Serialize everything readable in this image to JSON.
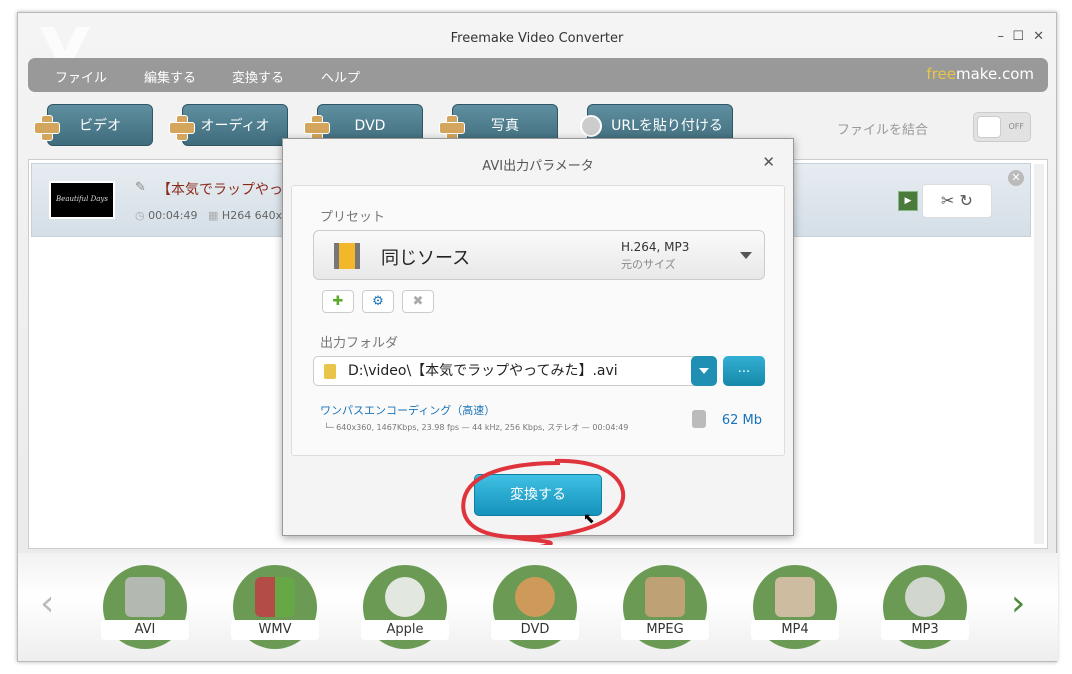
{
  "window": {
    "title": "Freemake Video Converter",
    "minimize": "–",
    "maximize": "☐",
    "close": "✕"
  },
  "menu": {
    "items": [
      "ファイル",
      "編集する",
      "変換する",
      "ヘルプ"
    ],
    "brand_free": "free",
    "brand_make": "make.com"
  },
  "toolbar": {
    "buttons": [
      "ビデオ",
      "オーディオ",
      "DVD",
      "写真",
      "URLを貼り付ける"
    ],
    "merge_label": "ファイルを結合",
    "merge_toggle": "OFF"
  },
  "file": {
    "name": "【本気でラップやって",
    "duration": "00:04:49",
    "codec": "H264  640x",
    "thumb_text": "Beautiful Days",
    "play": "▶",
    "edit_icons": "✂ ↻",
    "remove": "✕"
  },
  "dialog": {
    "title": "AVI出力パラメータ",
    "close": "✕",
    "preset_label": "プリセット",
    "preset_name": "同じソース",
    "preset_codec": "H.264, MP3",
    "preset_size": "元のサイズ",
    "add": "✚",
    "settings": "⚙",
    "delete": "✖",
    "folder_label": "出力フォルダ",
    "folder_path": "D:\\video\\【本気でラップやってみた】.avi",
    "browse": "...",
    "encoding": "ワンパスエンコーディング（高速）",
    "encoding_details": "└─ 640x360, 1467Kbps, 23.98 fps — 44 kHz, 256 Kbps, ステレオ — 00:04:49",
    "size": "62 Mb",
    "convert": "変換する"
  },
  "formats": {
    "items": [
      "AVI",
      "WMV",
      "Apple",
      "DVD",
      "MPEG",
      "MP4",
      "MP3"
    ],
    "prev": "‹",
    "next": "›"
  },
  "colors": {
    "accent": "#1592bb",
    "format_green": "#6b9a55",
    "annotation": "#e0343c"
  }
}
